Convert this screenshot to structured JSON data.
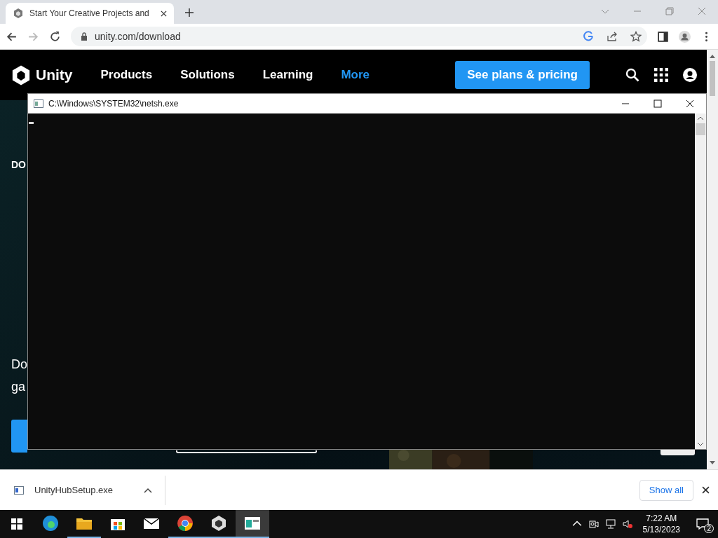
{
  "browser": {
    "tabs": [
      {
        "title": "Start Your Creative Projects and",
        "selected": true
      }
    ],
    "address": "unity.com/download"
  },
  "site_nav": {
    "logo": "Unity",
    "items": [
      {
        "label": "Products",
        "selected": false
      },
      {
        "label": "Solutions",
        "selected": false
      },
      {
        "label": "Learning",
        "selected": false
      },
      {
        "label": "More",
        "selected": true
      }
    ],
    "cta": "See plans & pricing"
  },
  "hero": {
    "eyebrow": "DO",
    "body": [
      "Do",
      "ga"
    ]
  },
  "console": {
    "title": "C:\\Windows\\SYSTEM32\\netsh.exe"
  },
  "downloads": {
    "file": "UnityHubSetup.exe",
    "show_all": "Show all"
  },
  "taskbar": {
    "apps": [
      {
        "kind": "edge",
        "running": false,
        "selected": false
      },
      {
        "kind": "folder",
        "running": true,
        "selected": false
      },
      {
        "kind": "store",
        "running": false,
        "selected": false
      },
      {
        "kind": "mail",
        "running": false,
        "selected": false
      },
      {
        "kind": "chrome",
        "running": true,
        "selected": false
      },
      {
        "kind": "unity",
        "running": true,
        "selected": false
      },
      {
        "kind": "console",
        "running": true,
        "selected": true
      }
    ],
    "time": "7:22 AM",
    "date": "5/13/2023",
    "notifications": "2"
  }
}
